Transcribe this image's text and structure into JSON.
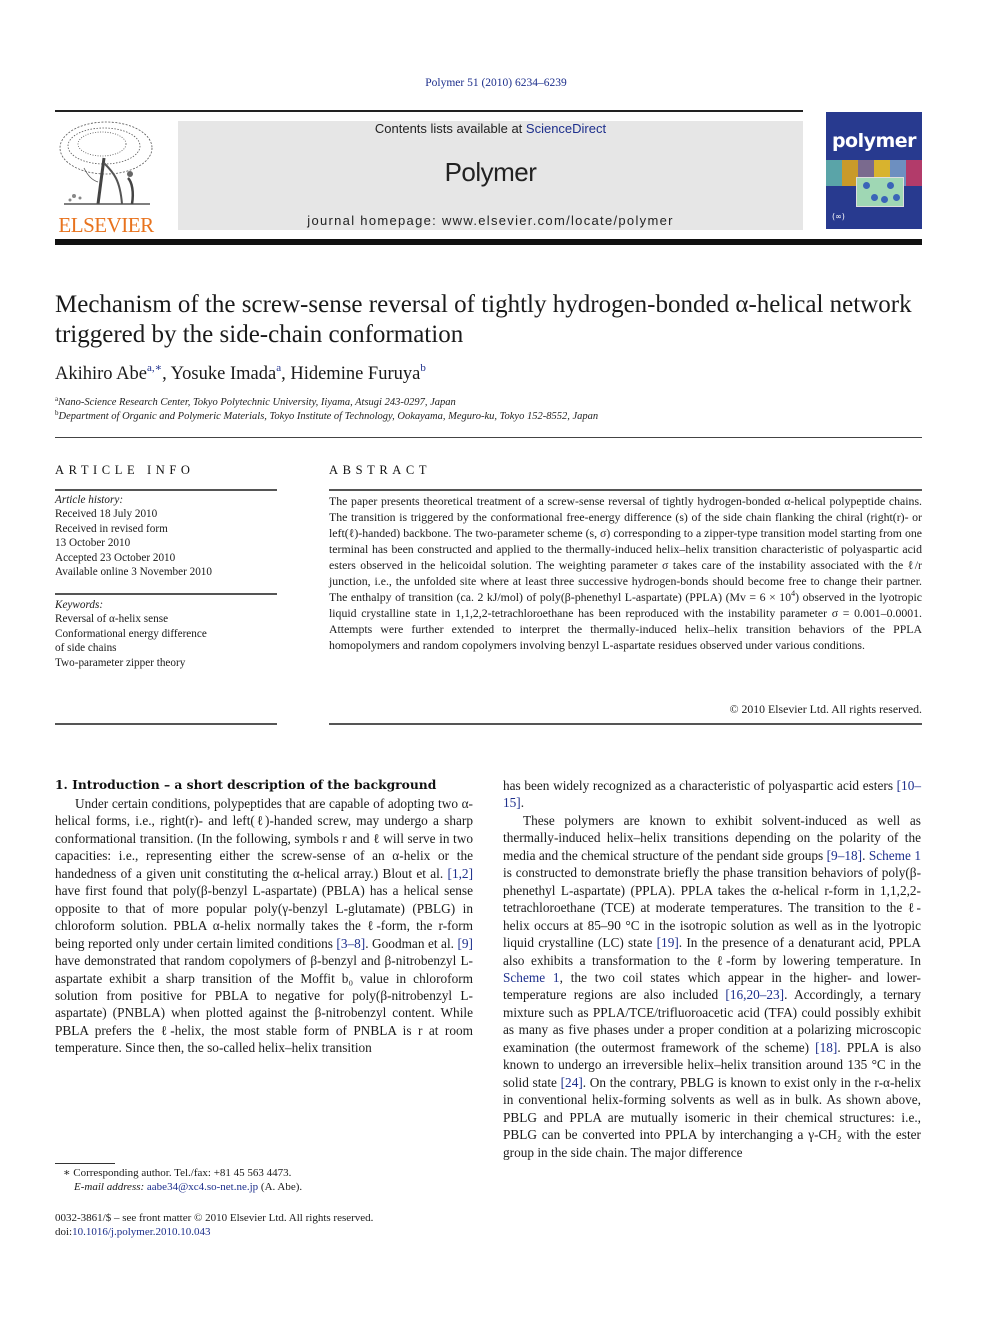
{
  "header": {
    "citation": "Polymer 51 (2010) 6234–6239",
    "contents_prefix": "Contents lists available at ",
    "contents_link": "ScienceDirect",
    "journal_title": "Polymer",
    "homepage_prefix": "journal homepage: ",
    "homepage_url": "www.elsevier.com/locate/polymer",
    "publisher_logo_text": "ELSEVIER",
    "cover_title": "polymer",
    "cover_strip_colors": [
      "#5aa4a8",
      "#c99a2a",
      "#7a6a8e",
      "#d8b32e",
      "#6d8fc0",
      "#b23b6a"
    ]
  },
  "article": {
    "title": "Mechanism of the screw-sense reversal of tightly hydrogen-bonded α-helical network triggered by the side-chain conformation",
    "authors": [
      {
        "name": "Akihiro Abe",
        "marks": "a,∗"
      },
      {
        "name": "Yosuke Imada",
        "marks": "a"
      },
      {
        "name": "Hidemine Furuya",
        "marks": "b"
      }
    ],
    "affiliations": [
      {
        "mark": "a",
        "text": "Nano-Science Research Center, Tokyo Polytechnic University, Iiyama, Atsugi 243-0297, Japan"
      },
      {
        "mark": "b",
        "text": "Department of Organic and Polymeric Materials, Tokyo Institute of Technology, Ookayama, Meguro-ku, Tokyo 152-8552, Japan"
      }
    ]
  },
  "article_info": {
    "heading": "ARTICLE INFO",
    "history_label": "Article history:",
    "history": [
      "Received 18 July 2010",
      "Received in revised form",
      "13 October 2010",
      "Accepted 23 October 2010",
      "Available online 3 November 2010"
    ],
    "keywords_label": "Keywords:",
    "keywords": [
      "Reversal of α-helix sense",
      "Conformational energy difference",
      "of side chains",
      "Two-parameter zipper theory"
    ]
  },
  "abstract": {
    "heading": "ABSTRACT",
    "text_1": "The paper presents theoretical treatment of a screw-sense reversal of tightly hydrogen-bonded α-helical polypeptide chains. The transition is triggered by the conformational free-energy difference (s) of the side chain flanking the chiral (right(r)- or left(ℓ)-handed) backbone. The two-parameter scheme (s, σ) corresponding to a zipper-type transition model starting from one terminal has been constructed and applied to the thermally-induced helix–helix transition characteristic of polyaspartic acid esters observed in the helicoidal solution. The weighting parameter σ takes care of the instability associated with the ℓ/r junction, i.e., the unfolded site where at least three successive hydrogen-bonds should become free to change their partner. The enthalpy of transition (ca. 2 kJ/mol) of poly(β-phenethyl L-aspartate) (PPLA) (Mv = 6 × 10",
    "superscript": "4",
    "text_2": ") observed in the lyotropic liquid crystalline state in 1,1,2,2-tetrachloroethane has been reproduced with the instability parameter σ = 0.001–0.0001. Attempts were further extended to interpret the thermally-induced helix–helix transition behaviors of the PPLA homopolymers and random copolymers involving benzyl L-aspartate residues observed under various conditions.",
    "copyright": "© 2010 Elsevier Ltd. All rights reserved."
  },
  "body": {
    "section_heading": "1.  Introduction – a short description of the background",
    "left_para": [
      {
        "t": "Under certain conditions, polypeptides that are capable of adopting two α-helical forms, i.e., right(r)- and left(ℓ)-handed screw, may undergo a sharp conformational transition. (In the following, symbols r and ℓ will serve in two capacities: i.e., representing either the screw-sense of an α-helix or the handedness of a given unit constituting the α-helical array.) Blout et al. "
      },
      {
        "ref": "[1,2]"
      },
      {
        "t": " have first found that poly(β-benzyl L-aspartate) (PBLA) has a helical sense opposite to that of more popular poly(γ-benzyl L-glutamate) (PBLG) in chloroform solution. PBLA α-helix normally takes the ℓ-form, the r-form being reported only under certain limited conditions "
      },
      {
        "ref": "[3–8]"
      },
      {
        "t": ". Goodman et al. "
      },
      {
        "ref": "[9]"
      },
      {
        "t": " have demonstrated that random copolymers of β-benzyl and β-nitrobenzyl L-aspartate exhibit a sharp transition of the Moffit b₀ value in chloroform solution from positive for PBLA to negative for poly(β-nitrobenzyl L-aspartate) (PNBLA) when plotted against the β-nitrobenzyl content. While PBLA prefers the ℓ-helix, the most stable form of PNBLA is r at room temperature. Since then, the so-called helix–helix transition"
      }
    ],
    "right_para_1": [
      {
        "t": "has been widely recognized as a characteristic of polyaspartic acid esters "
      },
      {
        "ref": "[10–15]"
      },
      {
        "t": "."
      }
    ],
    "right_para_2": [
      {
        "t": "These polymers are known to exhibit solvent-induced as well as thermally-induced helix–helix transitions depending on the polarity of the media and the chemical structure of the pendant side groups "
      },
      {
        "ref": "[9–18]"
      },
      {
        "t": ". "
      },
      {
        "ref": "Scheme 1"
      },
      {
        "t": " is constructed to demonstrate briefly the phase transition behaviors of poly(β-phenethyl L-aspartate) (PPLA). PPLA takes the α-helical r-form in 1,1,2,2-tetrachloroethane (TCE) at moderate temperatures. The transition to the ℓ-helix occurs at 85–90 °C in the isotropic solution as well as in the lyotropic liquid crystalline (LC) state "
      },
      {
        "ref": "[19]"
      },
      {
        "t": ". In the presence of a denaturant acid, PPLA also exhibits a transformation to the ℓ-form by lowering temperature. In "
      },
      {
        "ref": "Scheme 1"
      },
      {
        "t": ", the two coil states which appear in the higher- and lower-temperature regions are also included "
      },
      {
        "ref": "[16,20–23]"
      },
      {
        "t": ". Accordingly, a ternary mixture such as PPLA/TCE/trifluoroacetic acid (TFA) could possibly exhibit as many as five phases under a proper condition at a polarizing microscopic examination (the outermost framework of the scheme) "
      },
      {
        "ref": "[18]"
      },
      {
        "t": ". PPLA is also known to undergo an irreversible helix–helix transition around 135 °C in the solid state "
      },
      {
        "ref": "[24]"
      },
      {
        "t": ". On the contrary, PBLG is known to exist only in the r-α-helix in conventional helix-forming solvents as well as in bulk. As shown above, PBLG and PPLA are mutually isomeric in their chemical structures: i.e., PBLG can be converted into PPLA by interchanging a γ-CH₂ with the ester group in the side chain. The major difference"
      }
    ]
  },
  "footnotes": {
    "corresponding": "∗  Corresponding author. Tel./fax: +81 45 563 4473.",
    "email_label": "E-mail address: ",
    "email": "aabe34@xc4.so-net.ne.jp",
    "email_suffix": " (A. Abe).",
    "front_matter": "0032-3861/$ – see front matter © 2010 Elsevier Ltd. All rights reserved.",
    "doi_label": "doi:",
    "doi": "10.1016/j.polymer.2010.10.043"
  },
  "colors": {
    "link": "#1d2f8c",
    "elsevier_orange": "#e8731e",
    "banner_gray": "#e6e6e6",
    "cover_blue": "#283a8f"
  }
}
